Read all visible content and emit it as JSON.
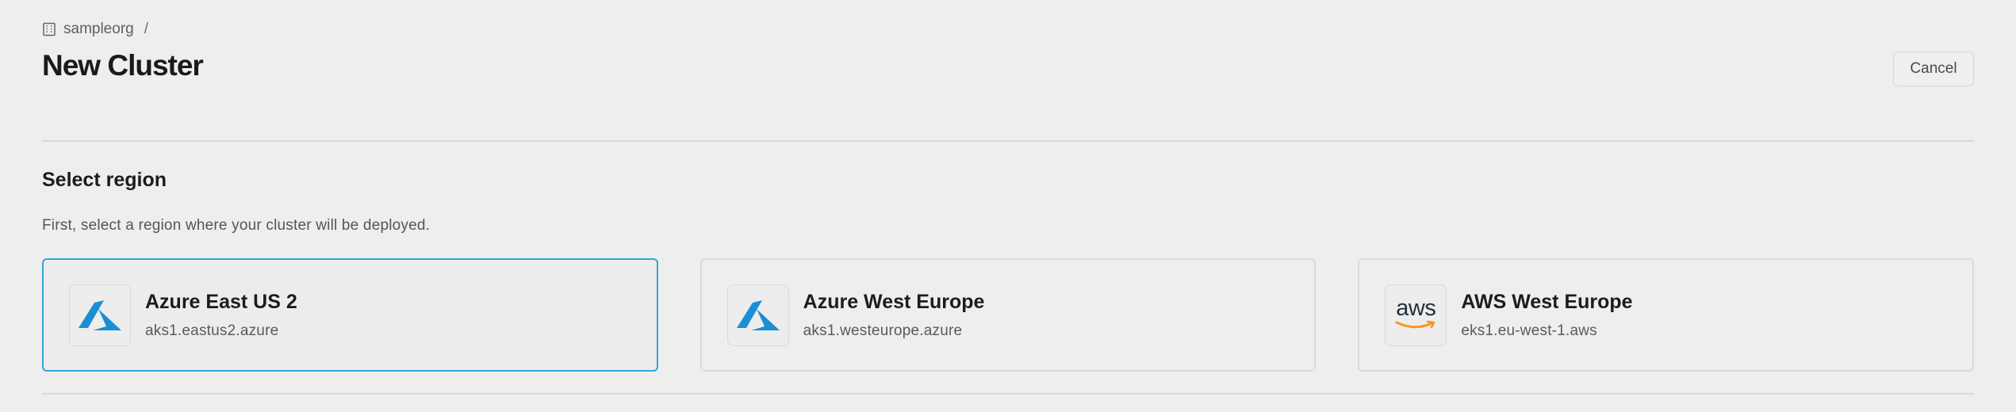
{
  "breadcrumb": {
    "org": "sampleorg",
    "separator": "/"
  },
  "page": {
    "title": "New Cluster"
  },
  "header": {
    "cancel_label": "Cancel"
  },
  "section": {
    "title": "Select region",
    "description": "First, select a region where your cluster will be deployed."
  },
  "regions": [
    {
      "name": "Azure East US 2",
      "host": "aks1.eastus2.azure",
      "provider": "azure",
      "icon": "azure-logo-icon",
      "selected": true
    },
    {
      "name": "Azure West Europe",
      "host": "aks1.westeurope.azure",
      "provider": "azure",
      "icon": "azure-logo-icon",
      "selected": false
    },
    {
      "name": "AWS West Europe",
      "host": "eks1.eu-west-1.aws",
      "provider": "aws",
      "aws_wordmark": "aws",
      "icon": "aws-logo-icon",
      "selected": false
    }
  ],
  "colors": {
    "background": "#eeeeee",
    "selected_border": "#32a6d4",
    "azure_blue": "#1a8fd3",
    "aws_orange": "#f7981f"
  }
}
